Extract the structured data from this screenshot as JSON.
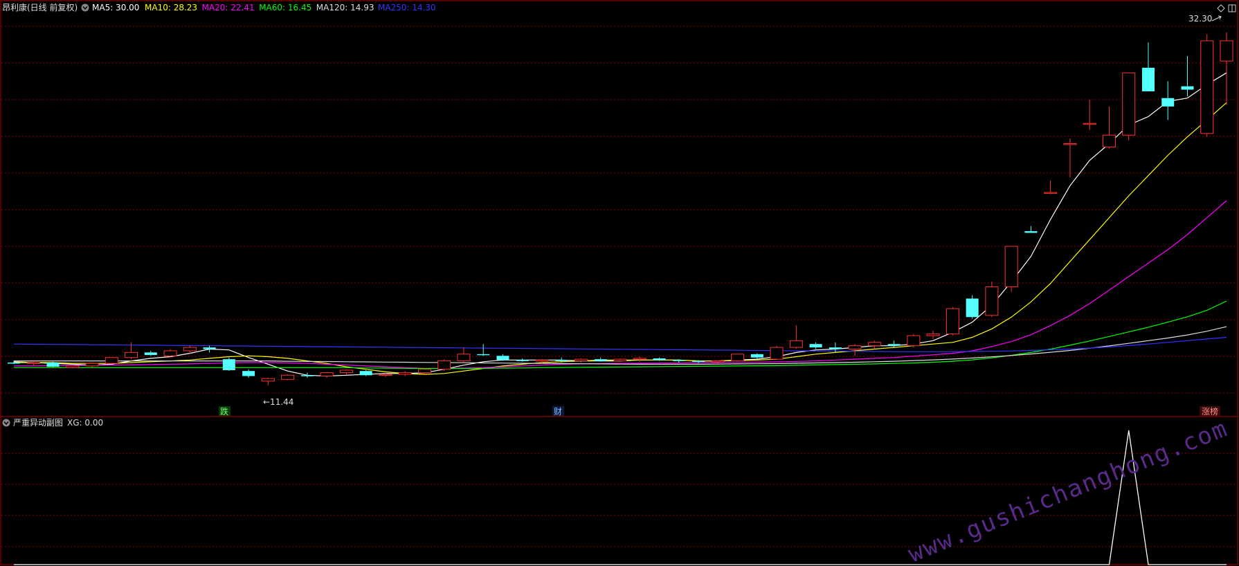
{
  "main_header": {
    "stock_title": "昂利康(日线 前复权)",
    "indicators": [
      {
        "label": "MA5: 30.00",
        "color": "#ffffff"
      },
      {
        "label": "MA10: 28.23",
        "color": "#ffff00"
      },
      {
        "label": "MA20: 22.41",
        "color": "#ff00ff"
      },
      {
        "label": "MA60: 16.45",
        "color": "#00ff00"
      },
      {
        "label": "MA120: 14.93",
        "color": "#dddddd"
      },
      {
        "label": "MA250: 14.30",
        "color": "#3333ff"
      }
    ]
  },
  "annotations": {
    "high_label": "32.30",
    "low_label": "←11.44",
    "event_markers": [
      "跌",
      "财",
      "涨榜"
    ]
  },
  "sub_header": {
    "title": "严重异动副图",
    "value_label": "XG: 0.00"
  },
  "watermark": "www.gushichanghong.com",
  "colors": {
    "up": "#ff3232",
    "down": "#54ffff",
    "grid": "#8b0000",
    "border": "#b00000",
    "ma5": "#ffffff",
    "ma10": "#ffff00",
    "ma20": "#ff00ff",
    "ma60": "#00ff00",
    "ma120": "#dddddd",
    "ma250": "#3333ff",
    "watermark": "#5a2a8a"
  },
  "chart_data": [
    {
      "type": "candlestick",
      "title": "昂利康(日线 前复权)",
      "ylim": [
        10.5,
        33.5
      ],
      "grid": true,
      "candles": [
        [
          12.8,
          12.9,
          12.7,
          12.75
        ],
        [
          12.75,
          12.9,
          12.6,
          12.8
        ],
        [
          12.8,
          12.85,
          12.5,
          12.55
        ],
        [
          12.5,
          12.65,
          12.45,
          12.6
        ],
        [
          12.6,
          12.8,
          12.5,
          12.75
        ],
        [
          12.75,
          13.1,
          12.7,
          13.1
        ],
        [
          13.1,
          14.0,
          13.0,
          13.4
        ],
        [
          13.4,
          13.5,
          13.2,
          13.25
        ],
        [
          13.2,
          13.6,
          13.1,
          13.5
        ],
        [
          13.5,
          13.8,
          13.3,
          13.7
        ],
        [
          13.7,
          13.8,
          13.4,
          13.6
        ],
        [
          13.0,
          13.1,
          12.3,
          12.35
        ],
        [
          12.3,
          12.4,
          11.9,
          12.0
        ],
        [
          11.7,
          11.9,
          11.44,
          11.85
        ],
        [
          11.8,
          12.1,
          11.75,
          12.05
        ],
        [
          12.05,
          12.2,
          11.9,
          12.0
        ],
        [
          12.0,
          12.25,
          11.9,
          12.2
        ],
        [
          12.2,
          12.4,
          12.1,
          12.35
        ],
        [
          12.3,
          12.35,
          12.0,
          12.05
        ],
        [
          12.05,
          12.2,
          11.95,
          12.1
        ],
        [
          12.1,
          12.3,
          12.0,
          12.2
        ],
        [
          12.2,
          12.45,
          12.1,
          12.4
        ],
        [
          12.4,
          13.0,
          12.3,
          12.9
        ],
        [
          12.9,
          13.7,
          12.8,
          13.3
        ],
        [
          13.3,
          13.9,
          13.2,
          13.25
        ],
        [
          13.2,
          13.3,
          12.9,
          12.95
        ],
        [
          12.95,
          13.05,
          12.85,
          12.9
        ],
        [
          12.9,
          13.0,
          12.75,
          12.95
        ],
        [
          12.95,
          13.1,
          12.8,
          12.9
        ],
        [
          12.9,
          13.05,
          12.8,
          13.0
        ],
        [
          13.0,
          13.1,
          12.85,
          12.9
        ],
        [
          12.9,
          13.05,
          12.85,
          13.0
        ],
        [
          13.0,
          13.15,
          12.85,
          13.05
        ],
        [
          13.05,
          13.1,
          12.9,
          12.95
        ],
        [
          12.95,
          13.0,
          12.8,
          12.9
        ],
        [
          12.9,
          12.95,
          12.75,
          12.85
        ],
        [
          12.85,
          12.9,
          12.75,
          12.9
        ],
        [
          12.9,
          13.3,
          12.85,
          13.3
        ],
        [
          13.3,
          13.35,
          13.0,
          13.1
        ],
        [
          13.0,
          13.8,
          12.95,
          13.7
        ],
        [
          13.7,
          15.0,
          13.6,
          14.1
        ],
        [
          13.9,
          14.0,
          13.6,
          13.7
        ],
        [
          13.7,
          14.0,
          13.4,
          13.6
        ],
        [
          13.6,
          13.9,
          13.2,
          13.8
        ],
        [
          13.8,
          14.1,
          13.6,
          14.0
        ],
        [
          13.9,
          14.1,
          13.7,
          13.8
        ],
        [
          13.8,
          14.5,
          13.7,
          14.4
        ],
        [
          14.4,
          14.7,
          14.2,
          14.5
        ],
        [
          14.5,
          16.1,
          14.4,
          16.0
        ],
        [
          16.6,
          16.8,
          15.4,
          15.5
        ],
        [
          15.6,
          17.6,
          15.5,
          17.3
        ],
        [
          17.3,
          18.5,
          17.0,
          19.7
        ],
        [
          20.6,
          20.9,
          20.5,
          20.5
        ],
        [
          22.9,
          23.6,
          22.8,
          22.9
        ],
        [
          25.8,
          26.1,
          23.8,
          25.8
        ],
        [
          27.0,
          28.4,
          26.6,
          27.0
        ],
        [
          25.6,
          28.0,
          25.5,
          26.3
        ],
        [
          26.3,
          30.0,
          26.0,
          30.0
        ],
        [
          30.3,
          31.8,
          29.5,
          28.9
        ],
        [
          28.5,
          29.5,
          27.2,
          28.0
        ],
        [
          29.2,
          31.0,
          28.6,
          29.0
        ],
        [
          26.4,
          32.3,
          26.2,
          31.9
        ],
        [
          30.7,
          32.4,
          28.1,
          31.9
        ]
      ],
      "series": [
        {
          "name": "MA5",
          "values": [
            12.85,
            12.8,
            12.75,
            12.7,
            12.65,
            12.7,
            12.9,
            13.05,
            13.15,
            13.35,
            13.6,
            13.55,
            13.1,
            12.7,
            12.3,
            12.05,
            12.0,
            12.05,
            12.1,
            12.15,
            12.15,
            12.2,
            12.4,
            12.65,
            12.85,
            12.95,
            12.95,
            12.95,
            12.95,
            12.9,
            12.9,
            12.9,
            12.95,
            12.95,
            12.95,
            12.9,
            12.9,
            12.95,
            13.0,
            13.15,
            13.4,
            13.55,
            13.6,
            13.7,
            13.8,
            13.8,
            13.9,
            14.1,
            14.6,
            15.2,
            16.2,
            17.6,
            19.1,
            21.3,
            23.3,
            24.8,
            25.8,
            26.9,
            27.4,
            28.3,
            28.5,
            29.3,
            30.0
          ]
        },
        {
          "name": "MA10",
          "values": [
            12.8,
            12.8,
            12.8,
            12.75,
            12.75,
            12.75,
            12.8,
            12.85,
            12.9,
            12.95,
            13.05,
            13.15,
            13.2,
            13.15,
            13.05,
            12.9,
            12.75,
            12.55,
            12.4,
            12.25,
            12.15,
            12.1,
            12.15,
            12.3,
            12.45,
            12.6,
            12.7,
            12.8,
            12.85,
            12.9,
            12.95,
            12.95,
            12.95,
            12.95,
            12.95,
            12.9,
            12.9,
            12.92,
            12.95,
            13.0,
            13.15,
            13.3,
            13.4,
            13.5,
            13.6,
            13.7,
            13.8,
            13.9,
            14.0,
            14.3,
            14.8,
            15.5,
            16.4,
            17.5,
            18.8,
            20.1,
            21.4,
            22.7,
            23.9,
            25.1,
            26.2,
            27.2,
            28.23
          ]
        },
        {
          "name": "MA20",
          "values": [
            12.6,
            12.6,
            12.62,
            12.63,
            12.64,
            12.65,
            12.66,
            12.68,
            12.7,
            12.72,
            12.75,
            12.78,
            12.8,
            12.8,
            12.78,
            12.75,
            12.7,
            12.65,
            12.6,
            12.55,
            12.5,
            12.45,
            12.45,
            12.47,
            12.5,
            12.55,
            12.6,
            12.65,
            12.7,
            12.72,
            12.74,
            12.75,
            12.76,
            12.77,
            12.78,
            12.79,
            12.8,
            12.81,
            12.82,
            12.84,
            12.87,
            12.9,
            12.95,
            13.0,
            13.05,
            13.1,
            13.18,
            13.26,
            13.35,
            13.5,
            13.75,
            14.05,
            14.45,
            15.0,
            15.6,
            16.3,
            17.1,
            17.9,
            18.7,
            19.5,
            20.4,
            21.4,
            22.41
          ]
        },
        {
          "name": "MA60",
          "values": [
            12.5,
            12.5,
            12.5,
            12.5,
            12.5,
            12.5,
            12.5,
            12.5,
            12.5,
            12.5,
            12.5,
            12.5,
            12.5,
            12.5,
            12.5,
            12.5,
            12.5,
            12.5,
            12.48,
            12.47,
            12.46,
            12.45,
            12.45,
            12.45,
            12.46,
            12.47,
            12.48,
            12.5,
            12.51,
            12.52,
            12.53,
            12.54,
            12.55,
            12.56,
            12.57,
            12.58,
            12.59,
            12.6,
            12.61,
            12.62,
            12.64,
            12.66,
            12.68,
            12.7,
            12.72,
            12.75,
            12.78,
            12.82,
            12.88,
            12.96,
            13.08,
            13.23,
            13.4,
            13.6,
            13.83,
            14.08,
            14.35,
            14.62,
            14.9,
            15.2,
            15.52,
            15.9,
            16.45
          ]
        },
        {
          "name": "MA120",
          "values": [
            12.9,
            12.9,
            12.9,
            12.9,
            12.9,
            12.9,
            12.9,
            12.9,
            12.9,
            12.9,
            12.9,
            12.9,
            12.9,
            12.9,
            12.88,
            12.87,
            12.86,
            12.85,
            12.84,
            12.83,
            12.82,
            12.81,
            12.8,
            12.79,
            12.78,
            12.77,
            12.76,
            12.75,
            12.74,
            12.73,
            12.72,
            12.71,
            12.7,
            12.7,
            12.7,
            12.7,
            12.71,
            12.72,
            12.73,
            12.74,
            12.76,
            12.78,
            12.8,
            12.82,
            12.85,
            12.88,
            12.92,
            12.96,
            13.01,
            13.07,
            13.14,
            13.22,
            13.31,
            13.41,
            13.52,
            13.65,
            13.79,
            13.94,
            14.1,
            14.26,
            14.44,
            14.66,
            14.93
          ]
        },
        {
          "name": "MA250",
          "values": [
            13.9,
            13.89,
            13.88,
            13.87,
            13.86,
            13.85,
            13.84,
            13.83,
            13.82,
            13.81,
            13.8,
            13.79,
            13.78,
            13.77,
            13.76,
            13.75,
            13.74,
            13.73,
            13.72,
            13.71,
            13.7,
            13.69,
            13.68,
            13.67,
            13.66,
            13.65,
            13.64,
            13.63,
            13.62,
            13.61,
            13.6,
            13.59,
            13.58,
            13.57,
            13.56,
            13.55,
            13.54,
            13.53,
            13.52,
            13.51,
            13.5,
            13.49,
            13.48,
            13.47,
            13.46,
            13.45,
            13.45,
            13.45,
            13.45,
            13.46,
            13.47,
            13.49,
            13.52,
            13.56,
            13.6,
            13.66,
            13.73,
            13.81,
            13.9,
            14.0,
            14.1,
            14.2,
            14.3
          ]
        }
      ]
    },
    {
      "type": "line",
      "title": "严重异动副图",
      "ylim": [
        0,
        1
      ],
      "series": [
        {
          "name": "XG",
          "values": [
            0,
            0,
            0,
            0,
            0,
            0,
            0,
            0,
            0,
            0,
            0,
            0,
            0,
            0,
            0,
            0,
            0,
            0,
            0,
            0,
            0,
            0,
            0,
            0,
            0,
            0,
            0,
            0,
            0,
            0,
            0,
            0,
            0,
            0,
            0,
            0,
            0,
            0,
            0,
            0,
            0,
            0,
            0,
            0,
            0,
            0,
            0,
            0,
            0,
            0,
            0,
            0,
            0,
            0,
            0,
            0,
            0,
            1,
            0,
            0,
            0,
            0,
            0
          ]
        }
      ]
    }
  ]
}
